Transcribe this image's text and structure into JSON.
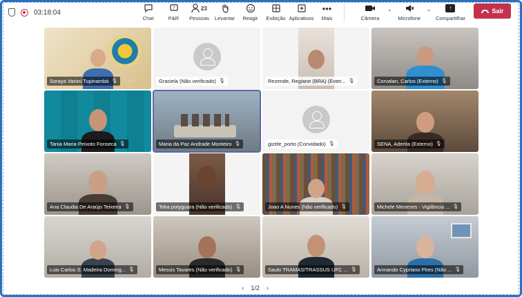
{
  "toolbar": {
    "timer": "03:18:04",
    "people_count": "23",
    "buttons": {
      "chat": "Chat",
      "qa": "P&R",
      "people": "Pessoas",
      "raise": "Levantar",
      "react": "Reagir",
      "view": "Exibição",
      "apps": "Aplicativos",
      "more": "Mais",
      "camera": "Câmera",
      "mic": "Microfone",
      "share": "Compartilhar",
      "leave": "Sair"
    }
  },
  "participants": [
    {
      "name": "Soraya Vanini Tupinambá"
    },
    {
      "name": "Graciela (Não verificado)"
    },
    {
      "name": "Rezende, Regiane (BRA) (Exter..."
    },
    {
      "name": "Corvalan, Carlos (Externo)"
    },
    {
      "name": "Tania Maria Peixoto Fonseca"
    },
    {
      "name": "Maria da Paz Andrade Monteiro"
    },
    {
      "name": "gizele_porto (Convidado)"
    },
    {
      "name": "SENA, Aderita (Externo)"
    },
    {
      "name": "Ana Claudia De Araújo Teixeira"
    },
    {
      "name": "Teka potyguara (Não verificado)"
    },
    {
      "name": "Joao A Nunes (Não verificado)"
    },
    {
      "name": "Michele Meneses - Vigilância ..."
    },
    {
      "name": "Luis Carlos S. Madeira Doming..."
    },
    {
      "name": "Messis Tavares (Não verificado)"
    },
    {
      "name": "Saulo TRAMAS/TRASSUS UFC ..."
    },
    {
      "name": "Armando Cypriano Pires (Não ..."
    }
  ],
  "pager": {
    "label": "1/2"
  },
  "colors": {
    "accent": "#6264a7",
    "leave": "#c4314b",
    "frame": "#2a6fc0"
  }
}
